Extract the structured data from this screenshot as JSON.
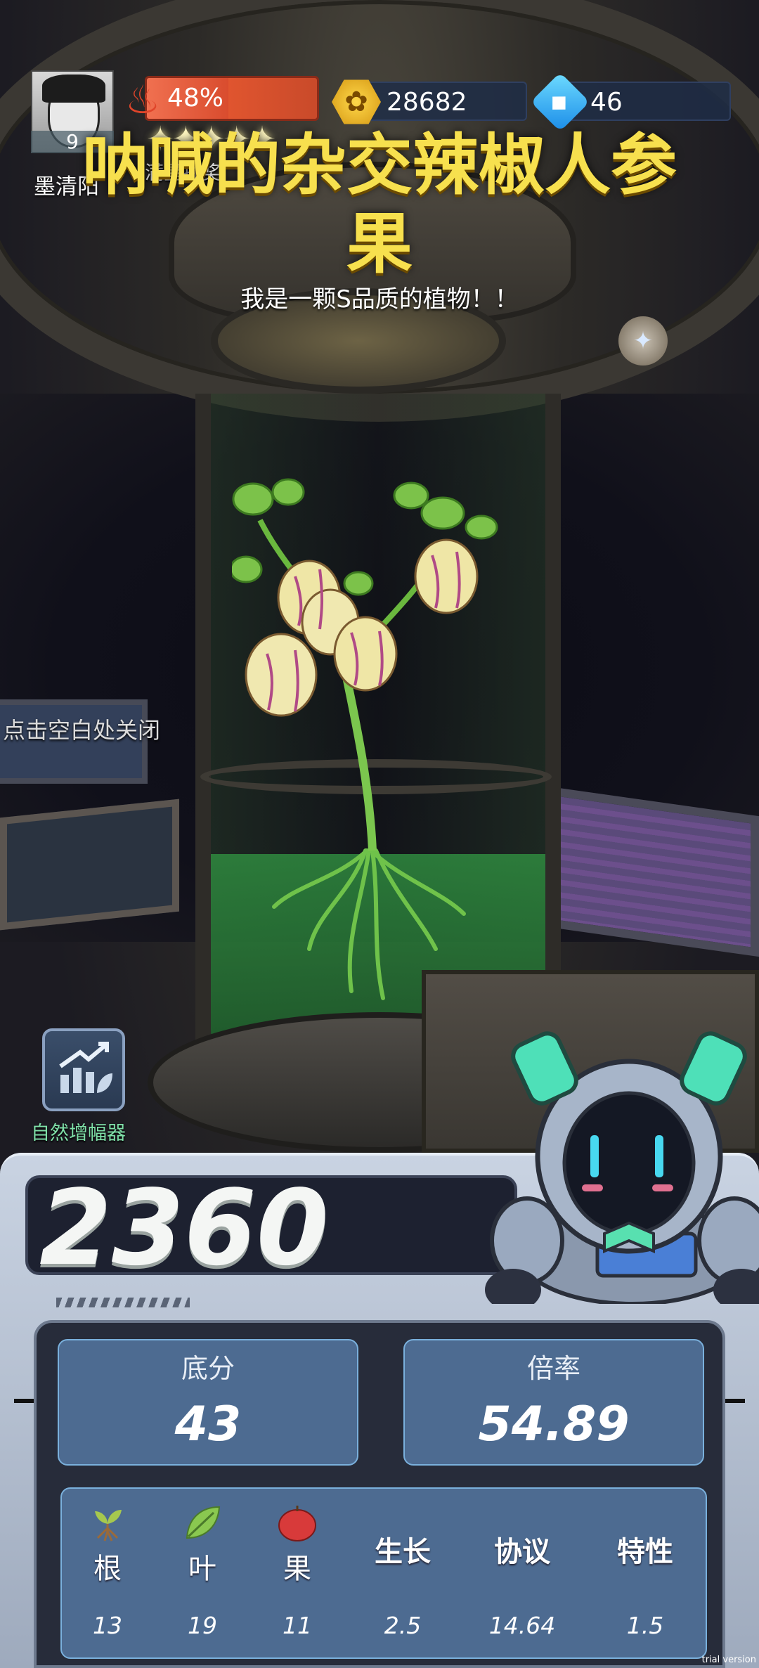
{
  "player": {
    "name": "墨清阳",
    "level": "9"
  },
  "energy": {
    "percent_text": "48%",
    "fill_fraction": 0.48
  },
  "stars": {
    "label": "满星抽奖",
    "glyphs": "✦✦✦✦✦"
  },
  "resources": {
    "gold": "28682",
    "gems": "46"
  },
  "plant": {
    "title": "呐喊的杂交辣椒人参果",
    "quality_text": "我是一颗S品质的植物！！"
  },
  "hints": {
    "close": "点击空白处关闭"
  },
  "amplifier": {
    "label": "自然增幅器",
    "icon": "growth-chart-icon"
  },
  "score": {
    "total": "2360"
  },
  "stats": {
    "base_label": "底分",
    "base_value": "43",
    "rate_label": "倍率",
    "rate_value": "54.89"
  },
  "attributes": [
    {
      "name": "根",
      "value": "13",
      "icon": "root-icon"
    },
    {
      "name": "叶",
      "value": "19",
      "icon": "leaf-icon"
    },
    {
      "name": "果",
      "value": "11",
      "icon": "fruit-icon"
    },
    {
      "name": "生长",
      "value": "2.5",
      "icon": ""
    },
    {
      "name": "协议",
      "value": "14.64",
      "icon": ""
    },
    {
      "name": "特性",
      "value": "1.5",
      "icon": ""
    }
  ],
  "watermark": "trial version",
  "colors": {
    "title_yellow": "#f7e04e",
    "energy_red": "#d94c2e",
    "card_blue": "#4d6b91",
    "liquid_green": "#2f8a3f"
  }
}
